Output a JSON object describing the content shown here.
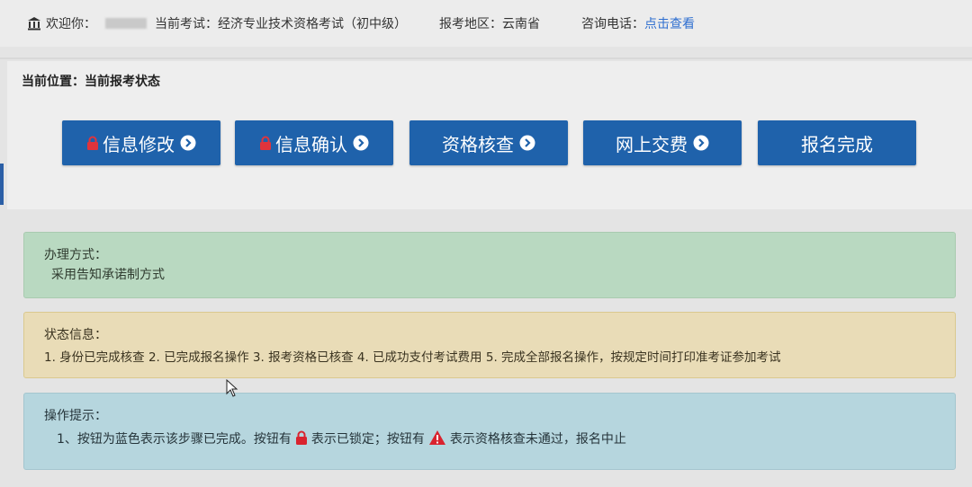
{
  "header": {
    "welcome_label": "欢迎你：",
    "exam_label": "当前考试：",
    "exam_value": "经济专业技术资格考试（初中级）",
    "region_label": "报考地区：",
    "region_value": "云南省",
    "phone_label": "咨询电话：",
    "phone_link": "点击查看"
  },
  "breadcrumb": "当前位置：当前报考状态",
  "steps": [
    {
      "label": "信息修改",
      "locked": true,
      "arrow": true
    },
    {
      "label": "信息确认",
      "locked": true,
      "arrow": true
    },
    {
      "label": "资格核查",
      "locked": false,
      "arrow": true
    },
    {
      "label": "网上交费",
      "locked": false,
      "arrow": true
    },
    {
      "label": "报名完成",
      "locked": false,
      "arrow": false
    }
  ],
  "method": {
    "title": "办理方式：",
    "text": "采用告知承诺制方式"
  },
  "status": {
    "title": "状态信息：",
    "text": "1. 身份已完成核查 2. 已完成报名操作 3. 报考资格已核查 4. 已成功支付考试费用 5. 完成全部报名操作，按规定时间打印准考证参加考试"
  },
  "tips": {
    "title": "操作提示：",
    "part1": "1、按钮为蓝色表示该步骤已完成。按钮有",
    "part2": "表示已锁定；按钮有",
    "part3": "表示资格核查未通过，报名中止"
  },
  "colors": {
    "button_blue": "#1f62ab",
    "link_blue": "#2f6fd0",
    "lock_red": "#d9232e",
    "warning_red": "#d9232e"
  },
  "icons": [
    "bank-icon",
    "lock-icon",
    "arrow-right-circle-icon",
    "warning-icon",
    "mouse-cursor-icon"
  ]
}
